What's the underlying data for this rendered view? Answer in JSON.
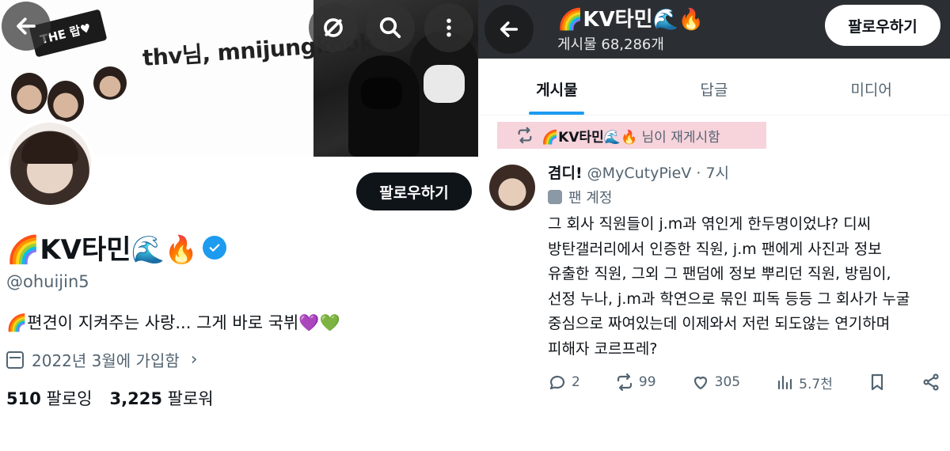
{
  "left_profile": {
    "banner": {
      "sticker_text": "THE 랍♥",
      "overlay_text": "thv님, mnijungkook님"
    },
    "follow_label": "팔로우하기",
    "display_name": "🌈KV타민🌊🔥",
    "handle": "@ohuijin5",
    "bio": "🌈편견이 지켜주는 사랑... 그게 바로 국뷔💜💚",
    "joined": "2022년 3월에 가입함",
    "following_count": "510",
    "following_label": "팔로잉",
    "followers_count": "3,225",
    "followers_label": "팔로워",
    "icons": [
      "back-arrow-icon",
      "visibility-off-icon",
      "search-icon",
      "more-vertical-icon",
      "verified-badge-icon",
      "calendar-icon",
      "chevron-right-icon"
    ]
  },
  "right_profile": {
    "header": {
      "name": "🌈KV타민🌊🔥",
      "posts_count": "게시물 68,286개",
      "follow_label": "팔로우하기"
    },
    "tabs": [
      {
        "label": "게시물",
        "active": true
      },
      {
        "label": "답글",
        "active": false
      },
      {
        "label": "미디어",
        "active": false
      }
    ],
    "repost": {
      "name": "🌈KV타민🌊🔥",
      "suffix": " 님이 재게시함"
    },
    "tweet": {
      "display_name": "겸디!",
      "handle_time": " @MyCutyPieV · 7시",
      "fan_label": "팬 계정",
      "lines": [
        "그 회사 직원들이 j.m과 엮인게 한두명이었냐? 디씨",
        "방탄갤러리에서 인증한 직원, j.m 팬에게 사진과 정보",
        "유출한 직원, 그외 그 팬덤에 정보 뿌리던 직원, 방림이,",
        "선정 누나, j.m과 학연으로 묶인 피독 등등 그 회사가 누굴",
        "중심으로 짜여있는데 이제와서 저런 되도않는 연기하며",
        "피해자 코르프레?"
      ],
      "replies": "2",
      "reposts": "99",
      "likes": "305",
      "views": "5.7천"
    }
  },
  "colors": {
    "accent_blue": "#1d9bf0",
    "text_primary": "#0f1419",
    "text_secondary": "#536471",
    "repost_highlight": "#f7d3dc"
  }
}
